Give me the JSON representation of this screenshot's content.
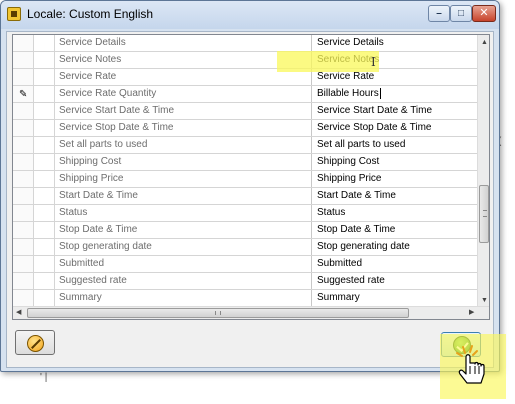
{
  "window": {
    "title": "Locale: Custom English",
    "controls": {
      "minimize": "–",
      "maximize": "□",
      "close": "✕"
    }
  },
  "grid": {
    "edit_row_index": 3,
    "edit_icon": "pencil-icon",
    "rows": [
      {
        "key": "Service Details",
        "value": "Service Details"
      },
      {
        "key": "Service Notes",
        "value": "Service Notes"
      },
      {
        "key": "Service Rate",
        "value": "Service Rate"
      },
      {
        "key": "Service Rate Quantity",
        "value": "Billable Hours"
      },
      {
        "key": "Service Start Date & Time",
        "value": "Service Start Date & Time"
      },
      {
        "key": "Service Stop Date & Time",
        "value": "Service Stop Date & Time"
      },
      {
        "key": "Set all parts to used",
        "value": "Set all parts to used"
      },
      {
        "key": "Shipping Cost",
        "value": "Shipping Cost"
      },
      {
        "key": "Shipping Price",
        "value": "Shipping Price"
      },
      {
        "key": "Start Date & Time",
        "value": "Start Date & Time"
      },
      {
        "key": "Status",
        "value": "Status"
      },
      {
        "key": "Stop Date & Time",
        "value": "Stop Date & Time"
      },
      {
        "key": "Stop generating date",
        "value": "Stop generating date"
      },
      {
        "key": "Submitted",
        "value": "Submitted"
      },
      {
        "key": "Suggested rate",
        "value": "Suggested rate"
      },
      {
        "key": "Summary",
        "value": "Summary"
      }
    ],
    "scroll": {
      "vertical_position": 0.58,
      "horizontal_position": 0.0
    }
  },
  "buttons": {
    "cancel": {
      "icon": "cancel-circle-icon"
    },
    "ok": {
      "icon": "check-circle-icon"
    }
  },
  "colors": {
    "highlight": "#faf85a",
    "title_bar": "#c5d6ec",
    "key_text": "#6d6d6d"
  }
}
